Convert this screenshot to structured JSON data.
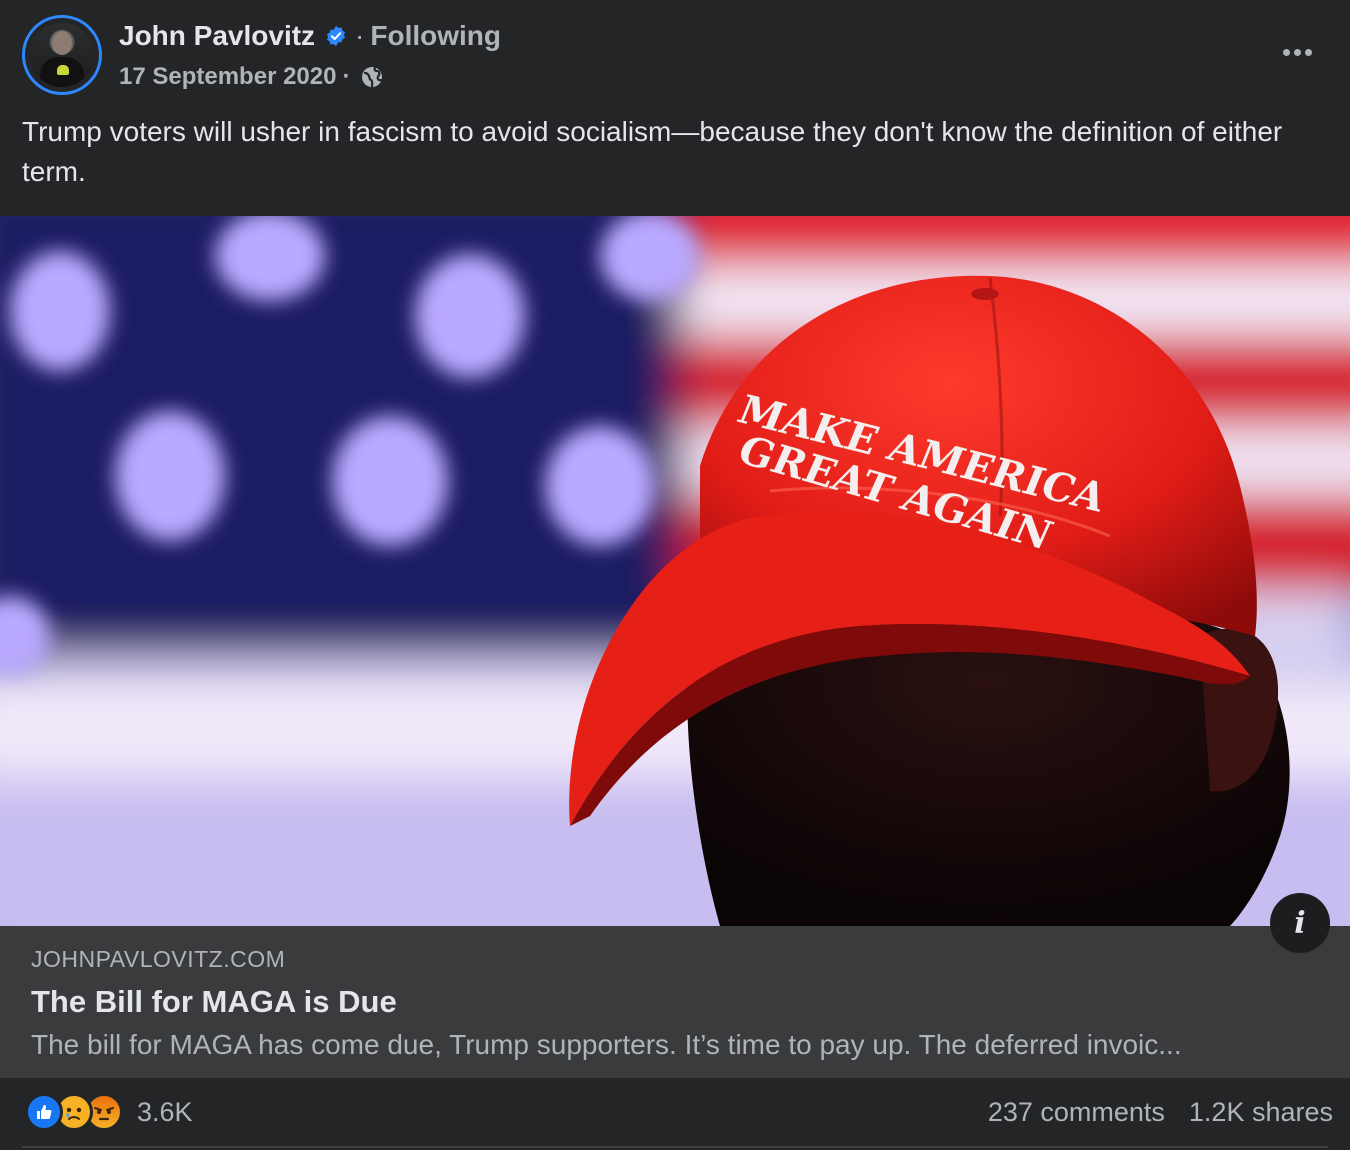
{
  "post": {
    "author": "John Pavlovitz",
    "separator": "·",
    "follow_status": "Following",
    "date": "17 September 2020",
    "date_separator": "·",
    "audience_icon": "globe-icon",
    "verified_icon": "verified-badge-icon",
    "text": "Trump voters will usher in fascism to avoid socialism—because they don't know the definition of either term."
  },
  "image": {
    "hat_text_line1": "MAKE AMERICA",
    "hat_text_line2": "GREAT AGAIN",
    "info_label": "i"
  },
  "link": {
    "domain": "JOHNPAVLOVITZ.COM",
    "title": "The Bill for MAGA is Due",
    "description": "The bill for MAGA has come due, Trump supporters. It’s time to pay up. The deferred invoic..."
  },
  "engagement": {
    "reaction_icons": [
      "like-icon",
      "sad-icon",
      "angry-icon"
    ],
    "reaction_count": "3.6K",
    "comments": "237 comments",
    "shares": "1.2K shares"
  },
  "colors": {
    "background": "#242526",
    "link_box": "#3a3b3c",
    "accent": "#2d88ff",
    "secondary_text": "#b0b3b8"
  }
}
